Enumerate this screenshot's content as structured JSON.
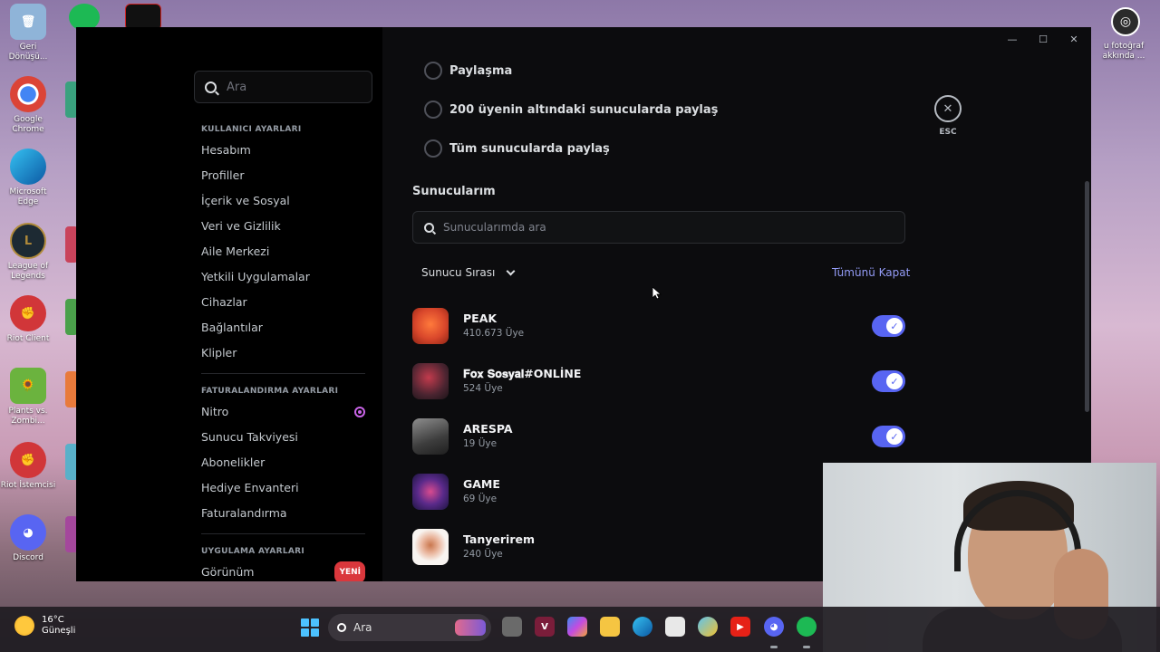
{
  "desktop": {
    "icons": [
      {
        "label": "Geri Dönüşü...",
        "name": "recycle-bin-icon",
        "color": "#8fb4d8"
      },
      {
        "label": "Google Chrome",
        "name": "chrome-icon",
        "color": "#db4437"
      },
      {
        "label": "Microsoft Edge",
        "name": "edge-icon",
        "color": "#0c7fcf"
      },
      {
        "label": "League of Legends",
        "name": "league-icon",
        "color": "#b08a3a"
      },
      {
        "label": "Riot Client",
        "name": "riot-client-icon",
        "color": "#d13639"
      },
      {
        "label": "Plants vs. Zombi...",
        "name": "plants-vs-zombies-icon",
        "color": "#6bb33e"
      },
      {
        "label": "Riot İstemcisi",
        "name": "riot-istemcisi-icon",
        "color": "#d13639"
      },
      {
        "label": "Discord",
        "name": "discord-desktop-icon",
        "color": "#5865f2"
      }
    ],
    "right_icon_label": "u fotoğraf akkında ..."
  },
  "window": {
    "controls": {
      "minimize": "—",
      "maximize": "☐",
      "close": "✕"
    }
  },
  "sidebar": {
    "search_placeholder": "Ara",
    "user_settings_header": "KULLANICI AYARLARI",
    "user_items": [
      "Hesabım",
      "Profiller",
      "İçerik ve Sosyal",
      "Veri ve Gizlilik",
      "Aile Merkezi",
      "Yetkili Uygulamalar",
      "Cihazlar",
      "Bağlantılar",
      "Klipler"
    ],
    "billing_header": "FATURALANDIRMA AYARLARI",
    "billing_items": [
      "Nitro",
      "Sunucu Takviyesi",
      "Abonelikler",
      "Hediye Envanteri",
      "Faturalandırma"
    ],
    "app_settings_header": "UYGULAMA AYARLARI",
    "app_items": [
      "Görünüm"
    ],
    "new_badge": "YENİ"
  },
  "content": {
    "radio_options": [
      "Paylaşma",
      "200 üyenin altındaki sunucularda paylaş",
      "Tüm sunucularda paylaş"
    ],
    "esc_label": "ESC",
    "servers_title": "Sunucularım",
    "servers_search_placeholder": "Sunucularımda ara",
    "sort_label": "Sunucu Sırası",
    "close_all_label": "Tümünü Kapat",
    "servers": [
      {
        "name": "PEAK",
        "members": "410.673 Üye",
        "toggle": true,
        "color": "#d9472b"
      },
      {
        "name": "𝐅𝐨𝐱 𝐒𝐨𝐬𝐲𝐚𝐥#ONLİNE",
        "members": "524 Üye",
        "toggle": true,
        "color": "#8c3b4a"
      },
      {
        "name": "ARESPA",
        "members": "19 Üye",
        "toggle": true,
        "color": "#5a5a5a"
      },
      {
        "name": "GAME",
        "members": "69 Üye",
        "toggle": false,
        "color": "#3a2a6e"
      },
      {
        "name": "Tanyerirem",
        "members": "240 Üye",
        "toggle": false,
        "color": "#f4f0ec"
      }
    ]
  },
  "taskbar": {
    "temperature": "16°C",
    "weather_text": "Güneşli",
    "search_placeholder": "Ara"
  }
}
